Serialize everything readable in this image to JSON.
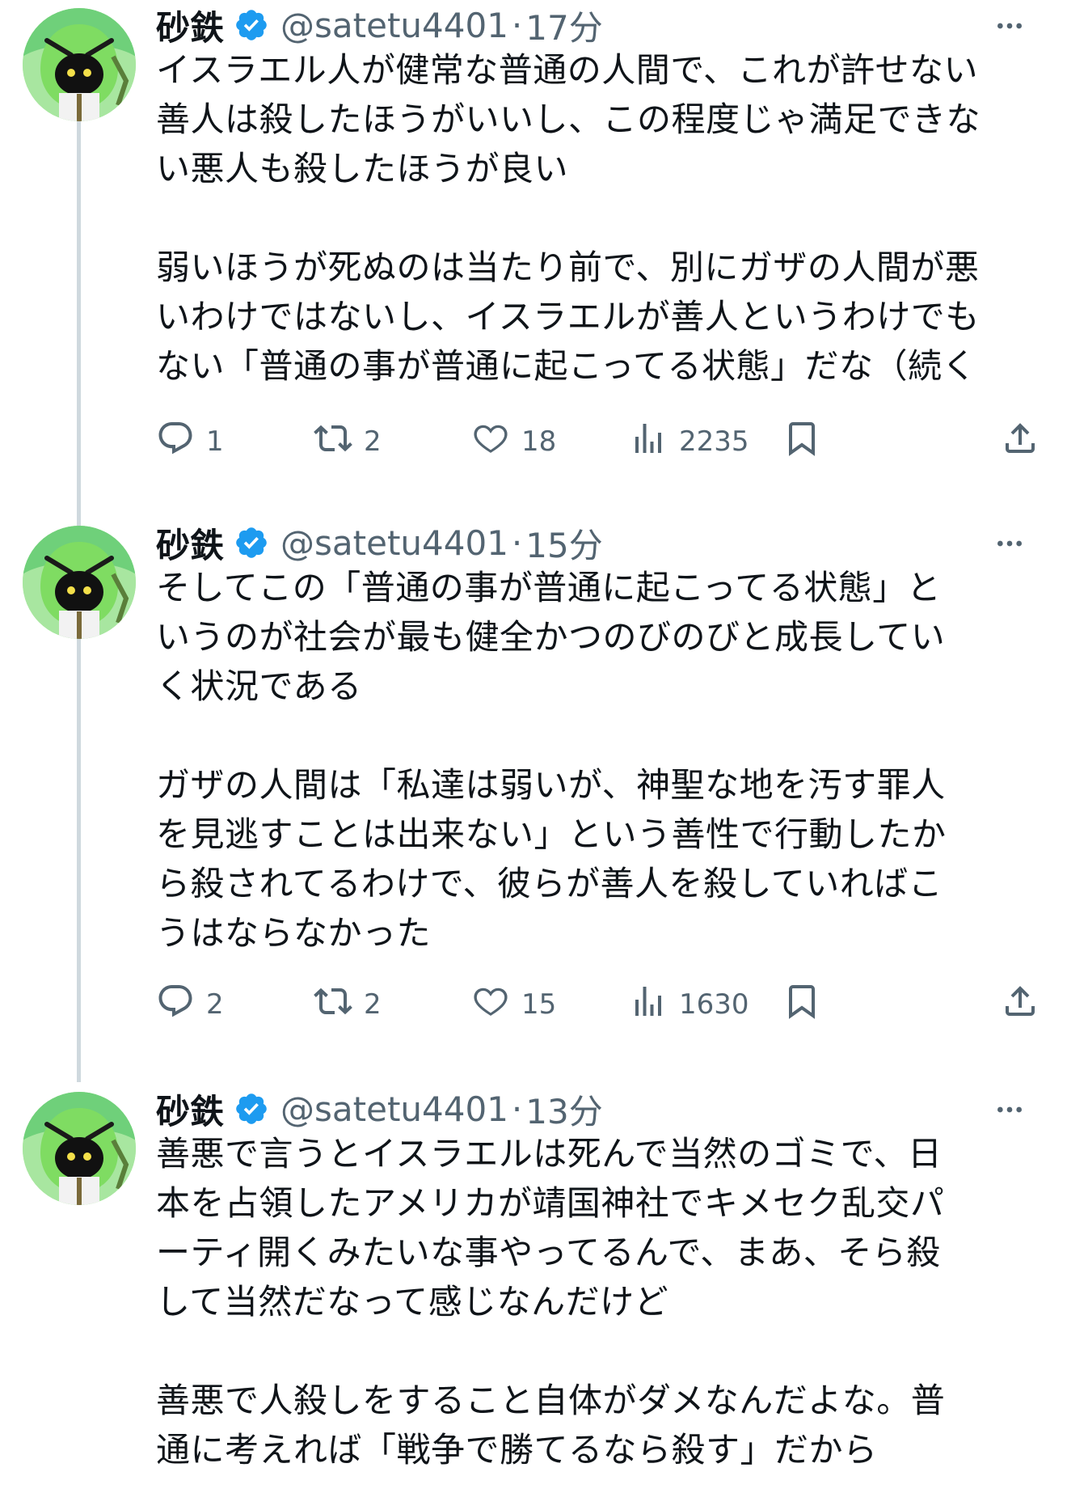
{
  "tweets": [
    {
      "name": "砂鉄",
      "handle": "@satetu4401",
      "separator": "·",
      "time": "17分",
      "paragraphs": [
        [
          "イスラエル人が健常な普通の人間で、これが許せない",
          "善人は殺したほうがいいし、この程度じゃ満足できな",
          "い悪人も殺したほうが良い"
        ],
        [
          "弱いほうが死ぬのは当たり前で、別にガザの人間が悪",
          "いわけではないし、イスラエルが善人というわけでも",
          "ない「普通の事が普通に起こってる状態」だな（続く"
        ]
      ],
      "counts": {
        "replies": "1",
        "reposts": "2",
        "likes": "18",
        "views": "2235"
      }
    },
    {
      "name": "砂鉄",
      "handle": "@satetu4401",
      "separator": "·",
      "time": "15分",
      "paragraphs": [
        [
          "そしてこの「普通の事が普通に起こってる状態」と",
          "いうのが社会が最も健全かつのびのびと成長してい",
          "く状況である"
        ],
        [
          "ガザの人間は「私達は弱いが、神聖な地を汚す罪人",
          "を見逃すことは出来ない」という善性で行動したか",
          "ら殺されてるわけで、彼らが善人を殺していればこ",
          "うはならなかった"
        ]
      ],
      "counts": {
        "replies": "2",
        "reposts": "2",
        "likes": "15",
        "views": "1630"
      }
    },
    {
      "name": "砂鉄",
      "handle": "@satetu4401",
      "separator": "·",
      "time": "13分",
      "paragraphs": [
        [
          "善悪で言うとイスラエルは死んで当然のゴミで、日",
          "本を占領したアメリカが靖国神社でキメセク乱交パ",
          "ーティ開くみたいな事やってるんで、まあ、そら殺",
          "して当然だなって感じなんだけど"
        ],
        [
          "善悪で人殺しをすること自体がダメなんだよな。普",
          "通に考えれば「戦争で勝てるなら殺す」だから"
        ]
      ]
    }
  ],
  "icons": {
    "verified": "verified-badge-icon",
    "more": "more-options-icon",
    "reply": "reply-icon",
    "repost": "repost-icon",
    "like": "like-icon",
    "views": "views-icon",
    "bookmark": "bookmark-icon",
    "share": "share-icon"
  },
  "colors": {
    "verified": "#1d9bf0",
    "muted": "#536471",
    "avatar_green": "#9be58a"
  }
}
